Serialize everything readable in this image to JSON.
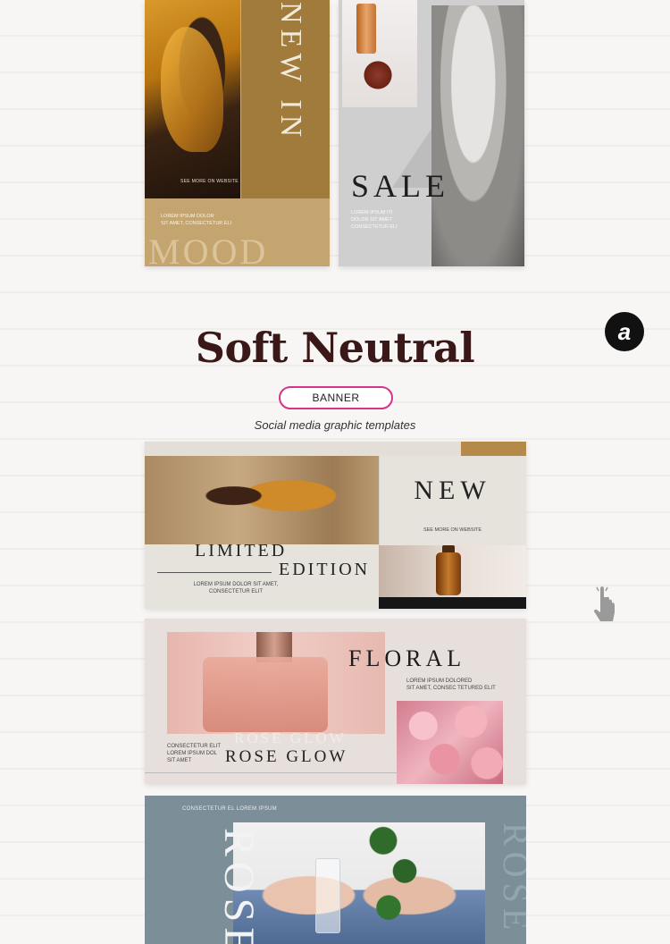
{
  "story1": {
    "vertical_title": "NEW IN",
    "see_more": "SEE MORE ON WEBSITE",
    "lorem": [
      "LOREM IPSUM DOLOR",
      "SIT AMET, CONSECTETUR ELI"
    ],
    "bottom_word": "MOOD"
  },
  "story2": {
    "title": "SALE",
    "lorem": [
      "LOREM IPSUM ITI",
      "DOLOR SIT AMET",
      "CONSECTETUR ELI"
    ]
  },
  "heading": {
    "title": "Soft Neutral",
    "badge": "BANNER",
    "subtitle": "Social media graphic templates"
  },
  "logo": {
    "glyph": "a",
    "icon": "brand-logo-icon"
  },
  "banner1": {
    "new": "NEW",
    "see_more": "SEE MORE ON WEBSITE",
    "limited": "LIMITED",
    "edition": "EDITION",
    "lorem": [
      "LOREM IPSUM DOLOR SIT AMET,",
      "CONSECTETUR ELIT"
    ]
  },
  "banner2": {
    "floral": "FLORAL",
    "lorem_right": [
      "LOREM IPSUM DOLORED",
      "SIT AMET, CONSEC TETURED ELIT"
    ],
    "lorem_left": [
      "CONSECTETUR ELIT",
      "LOREM IPSUM DOL",
      "SIT AMET"
    ],
    "ghost": "ROSE GLOW",
    "rose_glow": "ROSE GLOW"
  },
  "banner3": {
    "top_line": "CONSECTETUR EL LOREM IPSUM",
    "vertical_left": "ROSE",
    "vertical_right": "ROSE"
  },
  "colors": {
    "gold": "#a8823f",
    "title": "#3a1818",
    "badge_border": "#d8338a",
    "slate": "#7c8f98"
  }
}
